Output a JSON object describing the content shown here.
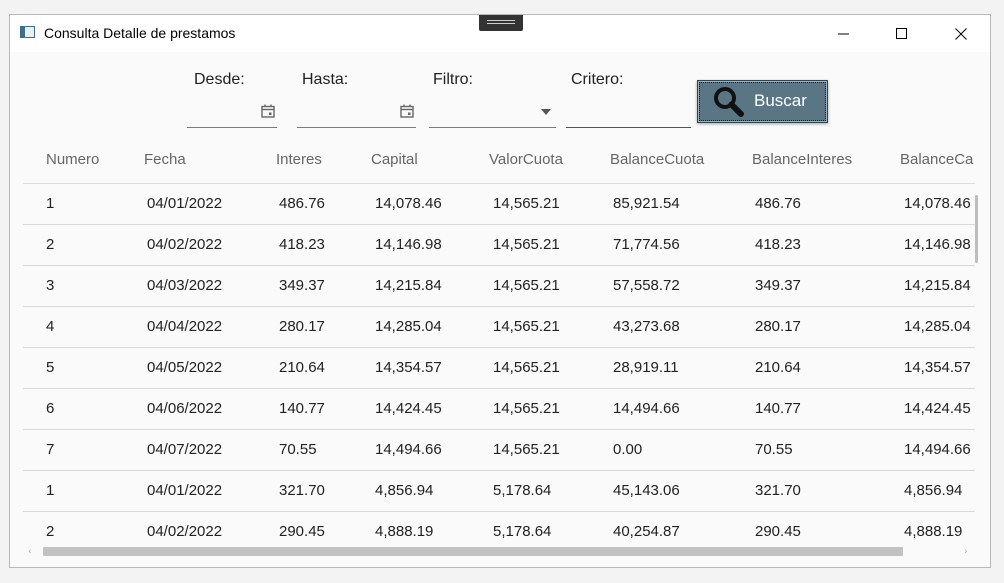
{
  "window": {
    "title": "Consulta Detalle de prestamos"
  },
  "filters": {
    "desde": {
      "label": "Desde:",
      "value": ""
    },
    "hasta": {
      "label": "Hasta:",
      "value": ""
    },
    "filtro": {
      "label": "Filtro:",
      "value": ""
    },
    "criterio": {
      "label": "Critero:",
      "value": ""
    },
    "buscar_label": "Buscar"
  },
  "table": {
    "columns": [
      "Numero",
      "Fecha",
      "Interes",
      "Capital",
      "ValorCuota",
      "BalanceCuota",
      "BalanceInteres",
      "BalanceCa"
    ],
    "rows": [
      [
        "1",
        "04/01/2022",
        "486.76",
        "14,078.46",
        "14,565.21",
        "85,921.54",
        "486.76",
        "14,078.46"
      ],
      [
        "2",
        "04/02/2022",
        "418.23",
        "14,146.98",
        "14,565.21",
        "71,774.56",
        "418.23",
        "14,146.98"
      ],
      [
        "3",
        "04/03/2022",
        "349.37",
        "14,215.84",
        "14,565.21",
        "57,558.72",
        "349.37",
        "14,215.84"
      ],
      [
        "4",
        "04/04/2022",
        "280.17",
        "14,285.04",
        "14,565.21",
        "43,273.68",
        "280.17",
        "14,285.04"
      ],
      [
        "5",
        "04/05/2022",
        "210.64",
        "14,354.57",
        "14,565.21",
        "28,919.11",
        "210.64",
        "14,354.57"
      ],
      [
        "6",
        "04/06/2022",
        "140.77",
        "14,424.45",
        "14,565.21",
        "14,494.66",
        "140.77",
        "14,424.45"
      ],
      [
        "7",
        "04/07/2022",
        "70.55",
        "14,494.66",
        "14,565.21",
        "0.00",
        "70.55",
        "14,494.66"
      ],
      [
        "1",
        "04/01/2022",
        "321.70",
        "4,856.94",
        "5,178.64",
        "45,143.06",
        "321.70",
        "4,856.94"
      ],
      [
        "2",
        "04/02/2022",
        "290.45",
        "4,888.19",
        "5,178.64",
        "40,254.87",
        "290.45",
        "4,888.19"
      ]
    ]
  },
  "scrollbar": {
    "left_arrow": "‹",
    "right_arrow": "›"
  }
}
